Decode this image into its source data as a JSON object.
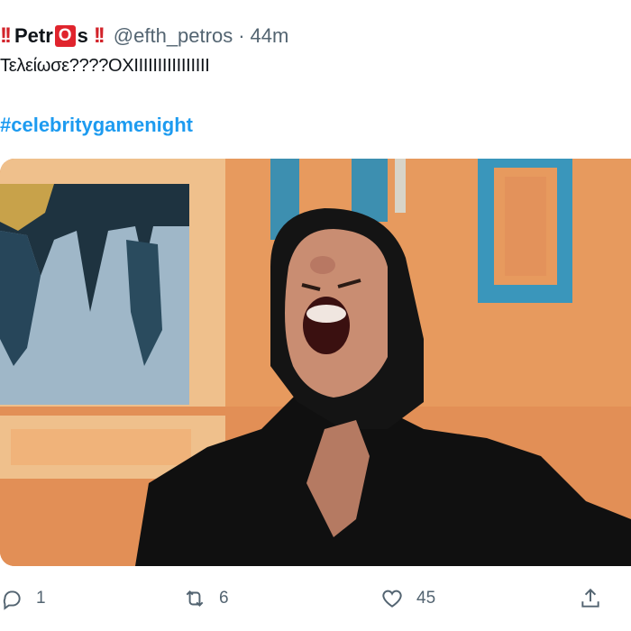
{
  "author": {
    "name_prefix": "Petr",
    "name_boxed_letter": "O",
    "name_suffix": "s",
    "emoji_left": "!!",
    "emoji_right": "!!",
    "handle": "@efth_petros",
    "separator": "·",
    "time": "44m"
  },
  "tweet": {
    "text": "Τελείωσε????ΟΧΙΙΙΙΙΙΙΙΙΙΙΙΙΙΙΙ",
    "hashtag": "#celebritygamenight"
  },
  "media": {
    "description_icon": "photo-icon"
  },
  "actions": {
    "reply_count": "1",
    "retweet_count": "6",
    "like_count": "45"
  },
  "colors": {
    "accent": "#1d9bf0",
    "text": "#0f1419",
    "secondary": "#536471",
    "emoji_red": "#d2232a"
  }
}
